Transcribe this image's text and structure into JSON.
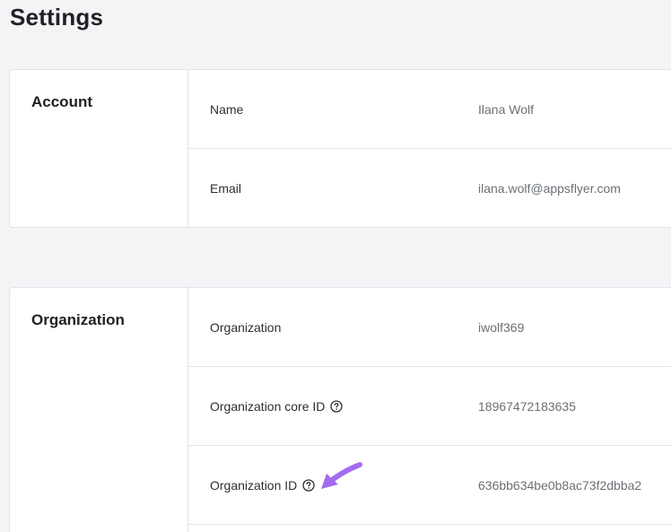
{
  "page": {
    "title": "Settings"
  },
  "account": {
    "section_title": "Account",
    "rows": [
      {
        "label": "Name",
        "value": "Ilana Wolf"
      },
      {
        "label": "Email",
        "value": "ilana.wolf@appsflyer.com"
      }
    ]
  },
  "organization": {
    "section_title": "Organization",
    "rows": [
      {
        "label": "Organization",
        "value": "iwolf369"
      },
      {
        "label": "Organization core ID",
        "value": "18967472183635",
        "icon": "help-circle-icon"
      },
      {
        "label": "Organization ID",
        "value": "636bb634be0b8ac73f2dbba2",
        "icon": "help-circle-icon"
      }
    ]
  },
  "annotation": {
    "arrow_color": "#a36bf0"
  }
}
